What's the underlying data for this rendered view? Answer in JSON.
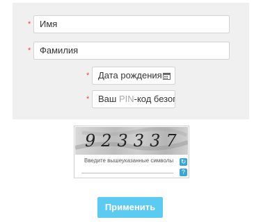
{
  "form": {
    "first_name_placeholder": "Имя",
    "last_name_placeholder": "Фамилия",
    "birth_date_placeholder": "Дата рождения",
    "pin_prefix": "Ваш ",
    "pin_highlight": "PIN",
    "pin_suffix": "-код безопас",
    "required_mark": "*"
  },
  "captcha": {
    "code": "923337",
    "hint": "Введите вышеуказанные символы"
  },
  "submit_label": "Применить",
  "icons": [
    "calendar-icon",
    "refresh-icon",
    "help-icon"
  ]
}
